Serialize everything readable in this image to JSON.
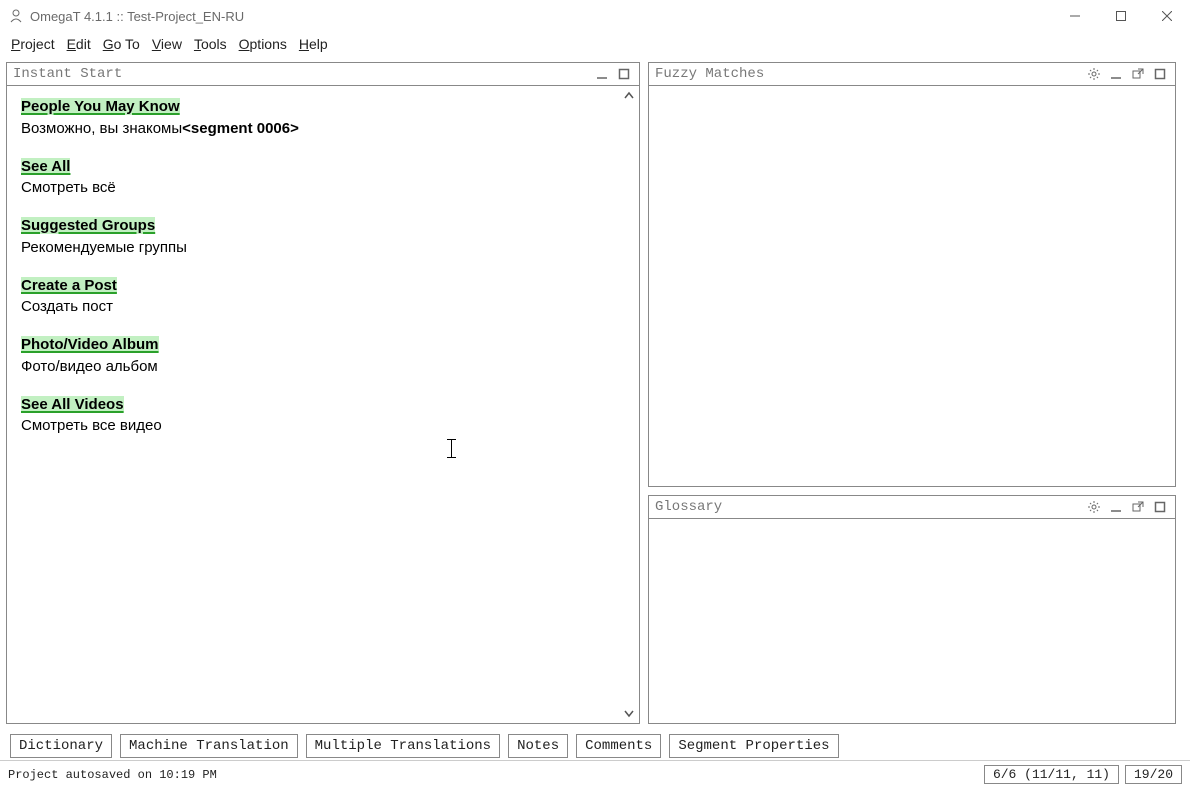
{
  "window": {
    "title": "OmegaT 4.1.1 :: Test-Project_EN-RU"
  },
  "menu": {
    "project": "Project",
    "edit": "Edit",
    "goto": "Go To",
    "view": "View",
    "tools": "Tools",
    "options": "Options",
    "help": "Help"
  },
  "panels": {
    "editor": {
      "title": "Instant Start"
    },
    "fuzzy": {
      "title": "Fuzzy Matches"
    },
    "glossary": {
      "title": "Glossary"
    }
  },
  "segments": [
    {
      "source": "People You May Know",
      "target": "Возможно, вы знакомы",
      "marker": "<segment 0006>"
    },
    {
      "source": "See All",
      "target": "Смотреть всё"
    },
    {
      "source": "Suggested Groups",
      "target": "Рекомендуемые группы"
    },
    {
      "source": "Create a Post",
      "target": "Создать пост"
    },
    {
      "source": "Photo/Video Album",
      "target": "Фото/видео альбом"
    },
    {
      "source": "See All Videos",
      "target": "Смотреть все видео"
    }
  ],
  "tabs": {
    "dictionary": "Dictionary",
    "machine_translation": "Machine Translation",
    "multiple_translations": "Multiple Translations",
    "notes": "Notes",
    "comments": "Comments",
    "segment_properties": "Segment Properties"
  },
  "status": {
    "autosave": "Project autosaved on 10:19 PM",
    "progress": "6/6 (11/11, 11)",
    "count": "19/20"
  }
}
